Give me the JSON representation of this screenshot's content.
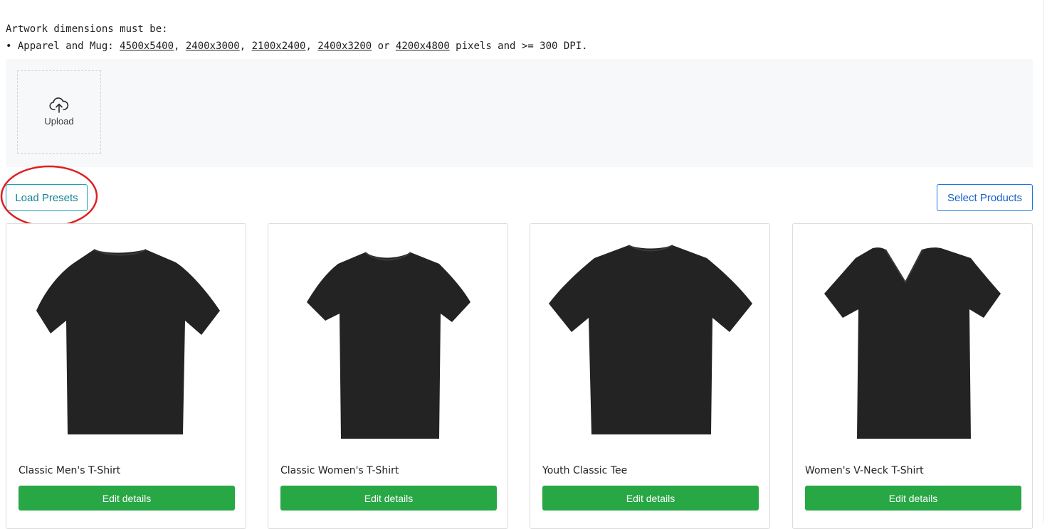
{
  "requirements": {
    "heading": "Artwork dimensions must be:",
    "bullet": "• Apparel and Mug: ",
    "dims": [
      "4500x5400",
      "2400x3000",
      "2100x2400",
      "2400x3200",
      "4200x4800"
    ],
    "sep1": ", ",
    "sep2": ", ",
    "sep3": ", ",
    "sep4": " or ",
    "suffix": " pixels and >= 300 DPI."
  },
  "upload": {
    "icon": "cloud-upload-icon",
    "label": "Upload"
  },
  "toolbar": {
    "load_presets": "Load Presets",
    "select_products": "Select Products"
  },
  "annotation": {
    "color": "#e02020"
  },
  "products": [
    {
      "title": "Classic Men's T-Shirt",
      "button": "Edit details",
      "image": "black-tshirt-icon"
    },
    {
      "title": "Classic Women's T-Shirt",
      "button": "Edit details",
      "image": "black-tshirt-icon"
    },
    {
      "title": "Youth Classic Tee",
      "button": "Edit details",
      "image": "black-tshirt-icon"
    },
    {
      "title": "Women's V-Neck T-Shirt",
      "button": "Edit details",
      "image": "black-vneck-tshirt-icon"
    }
  ],
  "colors": {
    "edit_button": "#28a745",
    "load_border": "#17a2b8",
    "select_border": "#1a73e8",
    "shirt": "#232323"
  }
}
